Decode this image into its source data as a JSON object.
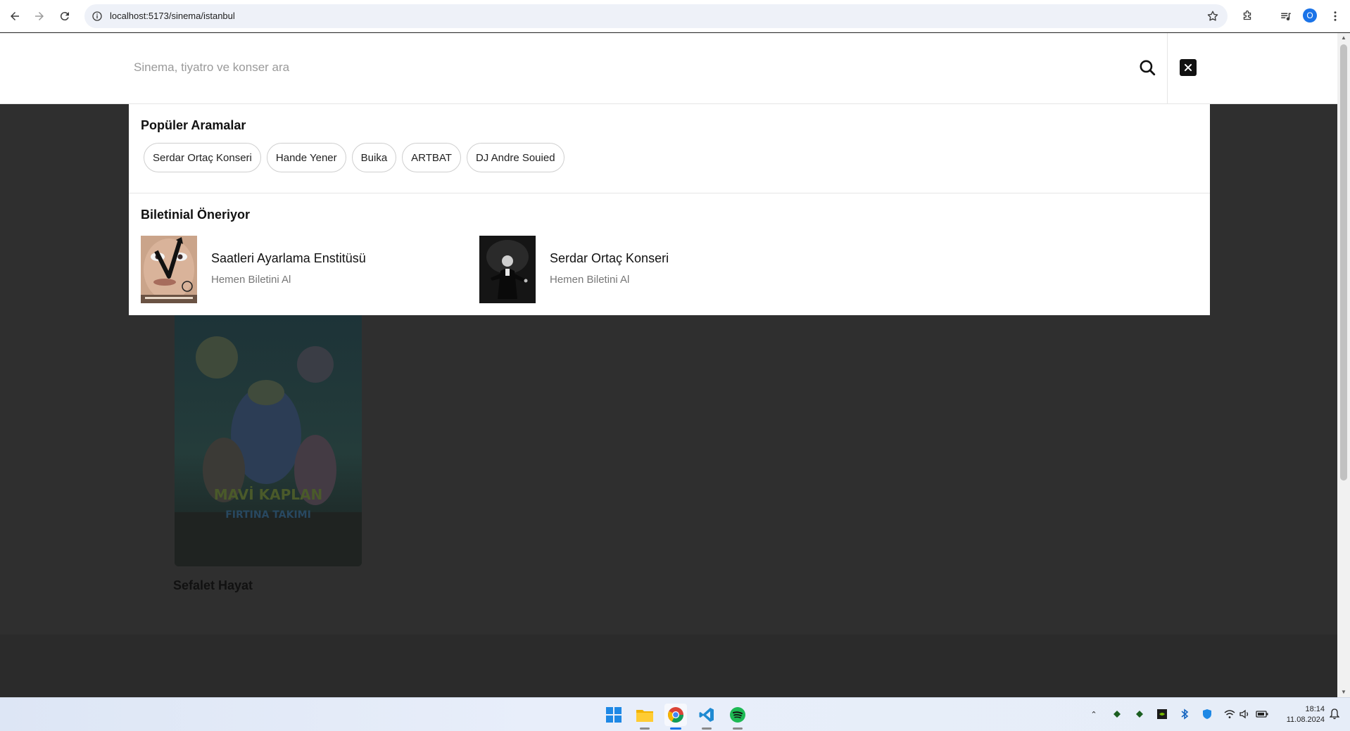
{
  "browser": {
    "url": "localhost:5173/sinema/istanbul",
    "profile_initial": "O"
  },
  "search": {
    "placeholder": "Sinema, tiyatro ve konser ara"
  },
  "popular": {
    "title": "Popüler Aramalar",
    "chips": [
      "Serdar Ortaç Konseri",
      "Hande Yener",
      "Buika",
      "ARTBAT",
      "DJ Andre Souied"
    ]
  },
  "recommend": {
    "title": "Biletinial Öneriyor",
    "items": [
      {
        "title": "Saatleri Ayarlama Enstitüsü",
        "subtitle": "Hemen Biletini Al"
      },
      {
        "title": "Serdar Ortaç Konseri",
        "subtitle": "Hemen Biletini Al"
      }
    ]
  },
  "movie": {
    "poster_title": "MAVİ KAPLAN",
    "poster_subtitle": "FIRTINA TAKIMI",
    "title": "Sefalet Hayat"
  },
  "taskbar": {
    "time": "18:14",
    "date": "11.08.2024"
  },
  "colors": {
    "overlay_bg": "#2f2f2f",
    "accent": "#1a73e8"
  }
}
